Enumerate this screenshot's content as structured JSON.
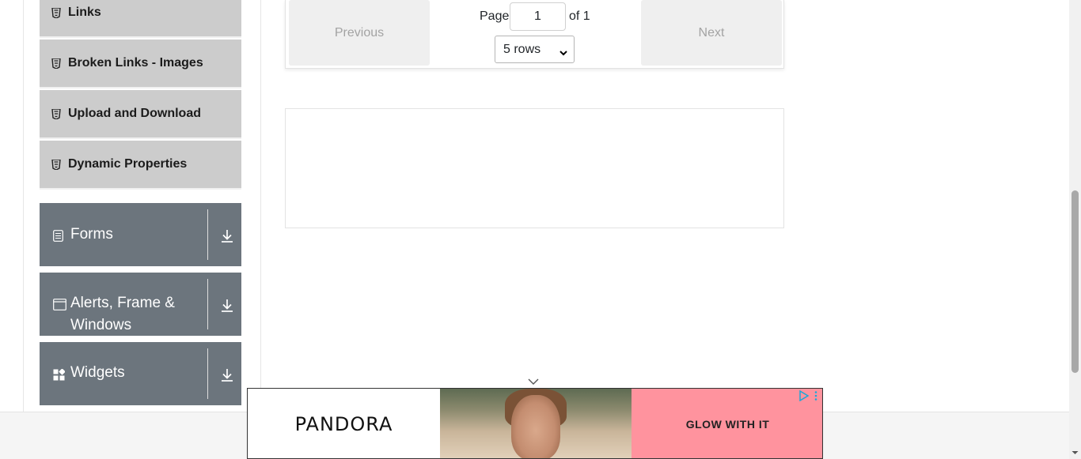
{
  "sidebar": {
    "elements_items": [
      {
        "label": "Links",
        "icon": "html5-icon"
      },
      {
        "label": "Broken Links - Images",
        "icon": "html5-icon"
      },
      {
        "label": "Upload and Download",
        "icon": "html5-icon"
      },
      {
        "label": "Dynamic Properties",
        "icon": "html5-icon"
      }
    ],
    "groups": [
      {
        "label": "Forms",
        "icon": "form-icon"
      },
      {
        "label": "Alerts, Frame & Windows",
        "label_line1": "Alerts, Frame &",
        "label_line2": "Windows",
        "icon": "window-icon"
      },
      {
        "label": "Widgets",
        "icon": "widgets-icon"
      }
    ]
  },
  "pagination": {
    "previous_label": "Previous",
    "next_label": "Next",
    "page_label": "Page",
    "page_value": "1",
    "of_label": "of 1",
    "rows_selected": "5 rows"
  },
  "ad": {
    "brand": "PANDORA",
    "cta": "GLOW WITH IT"
  },
  "colors": {
    "group_bg": "#6c757d",
    "sub_item_bg": "#cccccc",
    "ad_cta_bg": "#ff939e"
  }
}
